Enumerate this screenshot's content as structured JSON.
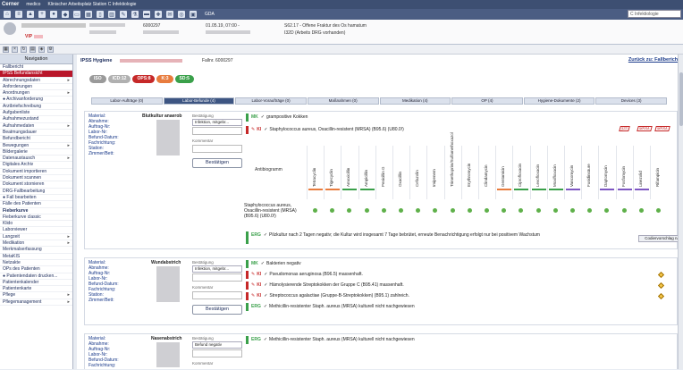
{
  "app": {
    "brand": "Cerner",
    "product": "medico",
    "title": "Klinischer Arbeitsplatz   Station C Infektiologie",
    "gda": "GDA",
    "search_placeholder": "C Infektiologie"
  },
  "patient": {
    "vip": "VIP",
    "fallnr": "6000297",
    "datetime": "01.05.19, 07:00 -",
    "diagnosis1": "S62.17 - Offene Fraktur des Os hamatum",
    "diagnosis2": "I32D (Arbeits DRG vorhanden)"
  },
  "navigation": {
    "header": "Navigation",
    "items": [
      {
        "label": "Fallbericht",
        "arrow": ""
      },
      {
        "label": "IPSS Befundansicht",
        "arrow": "",
        "active": true
      },
      {
        "label": "Abrechnungsdaten",
        "arrow": "▸"
      },
      {
        "label": "Anforderungen",
        "arrow": ""
      },
      {
        "label": "Anordnungen",
        "arrow": "▸"
      },
      {
        "label": "● Archivanforderung",
        "arrow": ""
      },
      {
        "label": "Arztbriefschreibung",
        "arrow": ""
      },
      {
        "label": "Aufgabenliste",
        "arrow": ""
      },
      {
        "label": "Aufnahmezustand",
        "arrow": ""
      },
      {
        "label": "Aufnahmedaten",
        "arrow": "▸"
      },
      {
        "label": "Beatmungsdauer",
        "arrow": ""
      },
      {
        "label": "Befundbericht",
        "arrow": ""
      },
      {
        "label": "Bewegungen",
        "arrow": "▸"
      },
      {
        "label": "Bildergalerie",
        "arrow": ""
      },
      {
        "label": "Datenaustausch",
        "arrow": "▸"
      },
      {
        "label": "Digitales Archiv",
        "arrow": ""
      },
      {
        "label": "Dokument importieren",
        "arrow": ""
      },
      {
        "label": "Dokument scannen",
        "arrow": ""
      },
      {
        "label": "Dokument stornieren",
        "arrow": ""
      },
      {
        "label": "DRG-Fallbearbeitung",
        "arrow": ""
      },
      {
        "label": "● Fall bearbeiten",
        "arrow": ""
      },
      {
        "label": "Fälle des Patienten",
        "arrow": ""
      },
      {
        "label": "Fieberkurve",
        "arrow": "",
        "bold": true
      },
      {
        "label": "Fieberkurve classic",
        "arrow": ""
      },
      {
        "label": "Klido",
        "arrow": ""
      },
      {
        "label": "Laborviewer",
        "arrow": ""
      },
      {
        "label": "Langzeit",
        "arrow": "▸"
      },
      {
        "label": "Medikation",
        "arrow": "▸"
      },
      {
        "label": "Merkmalserfassung",
        "arrow": ""
      },
      {
        "label": "MetaKIS",
        "arrow": ""
      },
      {
        "label": "Netzakte",
        "arrow": ""
      },
      {
        "label": "OPs des Patienten",
        "arrow": ""
      },
      {
        "label": "● Patientendaten drucken...",
        "arrow": ""
      },
      {
        "label": "Patientenkalender",
        "arrow": ""
      },
      {
        "label": "Patientenkarte",
        "arrow": ""
      },
      {
        "label": "Pflege",
        "arrow": "▸"
      },
      {
        "label": "Pflegemanagement",
        "arrow": "▸"
      }
    ]
  },
  "main": {
    "title": "IPSS Hygiene",
    "fallnr_label": "Fallnr. 6000297",
    "back_link": "Zurück zu: Fallbericht",
    "tags": [
      {
        "label": "ISO",
        "color": "#9a9a9a"
      },
      {
        "label": "ICD:12",
        "color": "#b0b0b0"
      },
      {
        "label": "OPS:8",
        "color": "#c62828"
      },
      {
        "label": "K:3",
        "color": "#e87c3e"
      },
      {
        "label": "SD:5",
        "color": "#3aa04a"
      }
    ],
    "tabs": [
      {
        "label": "Labor-Aufträge (0)"
      },
      {
        "label": "Labor-Befunde (4)",
        "active": true
      },
      {
        "label": "Labor-Voraufträge (0)"
      },
      {
        "label": "Maßnahmen (0)"
      },
      {
        "label": "Medikation (4)"
      },
      {
        "label": "OP (4)"
      },
      {
        "label": "Hygiene-Dokumente (2)"
      },
      {
        "label": "Devices (3)"
      }
    ]
  },
  "labels": {
    "material": "Material:",
    "abnahme": "Abnahme:",
    "auftrag": "Auftrag-Nr:",
    "labor": "Labor-Nr:",
    "befund": "Befund-Datum:",
    "fach": "Fachrichtung:",
    "station": "Station:",
    "zimmer": "Zimmer/Bett:",
    "bestaetigung": "Bestätigung",
    "kommentar": "Kommentar",
    "confirm_btn": "Bestätigen"
  },
  "cards": [
    {
      "specimen": "Blutkultur anaerob",
      "status": "Infektion, mitgebr...",
      "rows": [
        {
          "code": "MK",
          "type": "mk",
          "text": "grampositive Kokken"
        },
        {
          "code": "KI",
          "type": "ki",
          "text": "Staphylococcus aureus, Oxacillin-resistent (MRSA) (B95.6) (U80.0!)"
        }
      ],
      "badges": [
        "§23",
        "MRSA",
        "MRSA"
      ],
      "antibiogram_label": "Antibiogramm",
      "organism": "Staphylococcus aureus, Oxacillin-resistent (MRSA) (B95.6) (U80.0!)",
      "antibiotics": [
        {
          "name": "Tetracyclin",
          "bar": "#e87c3e"
        },
        {
          "name": "Tigecyclin",
          "bar": "#e87c3e"
        },
        {
          "name": "Amoxicillin",
          "bar": "#3aa04a"
        },
        {
          "name": "Ampicillin",
          "bar": "#3aa04a"
        },
        {
          "name": "Penicillin G",
          "bar": ""
        },
        {
          "name": "Oxacillin",
          "bar": ""
        },
        {
          "name": "Cefazolin",
          "bar": ""
        },
        {
          "name": "Imipenem",
          "bar": ""
        },
        {
          "name": "Trimethoprim/Sulfamethoxazol",
          "bar": ""
        },
        {
          "name": "Erythromycin",
          "bar": ""
        },
        {
          "name": "Clindamycin",
          "bar": ""
        },
        {
          "name": "Gentamicin",
          "bar": "#e87c3e"
        },
        {
          "name": "Ciprofloxacin",
          "bar": "#3aa04a"
        },
        {
          "name": "Levofloxacin",
          "bar": "#3aa04a"
        },
        {
          "name": "Moxifloxacin",
          "bar": "#3aa04a"
        },
        {
          "name": "Vancomycin",
          "bar": "#7e57c2"
        },
        {
          "name": "Fusidinsäure",
          "bar": ""
        },
        {
          "name": "Daptomycin",
          "bar": "#7e57c2"
        },
        {
          "name": "Fosfomycin",
          "bar": "#7e57c2"
        },
        {
          "name": "Linezolid",
          "bar": "#7e57c2"
        },
        {
          "name": "Rifampicin",
          "bar": ""
        }
      ],
      "erg": "Pilzkultur nach 2 Tagen negativ; die Kultur wird insgesamt 7 Tage bebrütet, erneute Benachrichtigung erfolgt nur bei positivem Wachstum",
      "codier_btn": "Codiervorschlag nac..."
    },
    {
      "specimen": "Wundabstrich",
      "status": "Infektion, mitgebr...",
      "rows": [
        {
          "code": "MK",
          "type": "mk",
          "text": "Bakterien negativ"
        },
        {
          "code": "KI",
          "type": "ki",
          "text": "Pseudomonas aeruginosa (B96.5) massenhaft."
        },
        {
          "code": "KI",
          "type": "ki",
          "text": "Hämolysierende Streptokokken der Gruppe C (B95.41) massenhaft."
        },
        {
          "code": "KI",
          "type": "ki",
          "text": "Streptococcus agalactiae (Gruppe-B-Streptokokken) (B95.1) zahlreich."
        },
        {
          "code": "ERG",
          "type": "erg",
          "text": "Methicillin-resistenter Staph. aureus (MRSA) kulturell nicht nachgewiesen"
        }
      ]
    },
    {
      "specimen": "Nasenabstrich",
      "status": "Befund negativ",
      "rows": [
        {
          "code": "ERG",
          "type": "erg",
          "text": "Methicillin-resistenter Staph. aureus (MRSA) kulturell nicht nachgewiesen"
        }
      ]
    }
  ]
}
